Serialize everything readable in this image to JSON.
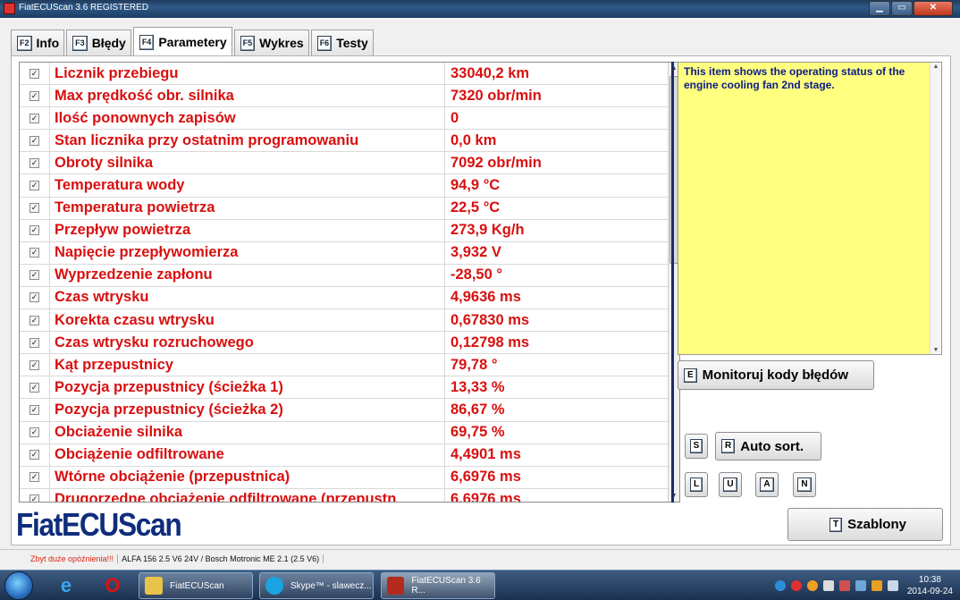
{
  "window": {
    "title": "FiatECUScan 3.6 REGISTERED"
  },
  "tabs": [
    {
      "key": "F2",
      "label": "Info"
    },
    {
      "key": "F3",
      "label": "Błędy"
    },
    {
      "key": "F4",
      "label": "Parametery"
    },
    {
      "key": "F5",
      "label": "Wykres"
    },
    {
      "key": "F6",
      "label": "Testy"
    }
  ],
  "params": [
    {
      "name": "Licznik przebiegu",
      "value": "33040,2 km"
    },
    {
      "name": "Max prędkość obr. silnika",
      "value": "7320 obr/min"
    },
    {
      "name": "Ilość ponownych zapisów",
      "value": "0"
    },
    {
      "name": "Stan licznika przy ostatnim programowaniu",
      "value": "0,0 km"
    },
    {
      "name": "Obroty silnika",
      "value": "7092 obr/min"
    },
    {
      "name": "Temperatura wody",
      "value": "94,9 °C"
    },
    {
      "name": "Temperatura powietrza",
      "value": "22,5 °C"
    },
    {
      "name": "Przepływ powietrza",
      "value": "273,9 Kg/h"
    },
    {
      "name": "Napięcie przepływomierza",
      "value": "3,932 V"
    },
    {
      "name": "Wyprzedzenie zapłonu",
      "value": "-28,50 °"
    },
    {
      "name": "Czas wtrysku",
      "value": "4,9636 ms"
    },
    {
      "name": "Korekta czasu wtrysku",
      "value": "0,67830 ms"
    },
    {
      "name": "Czas wtrysku rozruchowego",
      "value": "0,12798 ms"
    },
    {
      "name": "Kąt przepustnicy",
      "value": "79,78 °"
    },
    {
      "name": "Pozycja przepustnicy (ścieżka 1)",
      "value": "13,33 %"
    },
    {
      "name": "Pozycja przepustnicy (ścieżka 2)",
      "value": "86,67 %"
    },
    {
      "name": "Obciażenie silnika",
      "value": "69,75 %"
    },
    {
      "name": "Obciążenie odfiltrowane",
      "value": "4,4901 ms"
    },
    {
      "name": "Wtórne obciążenie (przepustnica)",
      "value": "6,6976 ms"
    },
    {
      "name": "Drugorzedne obciażenie odfiltrowane (przepustn",
      "value": "6,6976 ms"
    }
  ],
  "info": {
    "text": "This item shows the operating status of the engine cooling fan 2nd stage."
  },
  "buttons": {
    "monitor": {
      "key": "E",
      "label": "Monitoruj kody błędów"
    },
    "s_key": "S",
    "autosort": {
      "key": "R",
      "label": "Auto sort."
    },
    "l_key": "L",
    "u_key": "U",
    "a_key": "A",
    "n_key": "N",
    "templates": {
      "key": "T",
      "label": "Szablony"
    }
  },
  "logo": "FiatECUScan",
  "status": {
    "warning": "Zbyt duże opóźnienia!!!",
    "vehicle": "ALFA 156 2.5 V6 24V / Bosch Motronic ME 2.1 (2.5 V6)"
  },
  "taskbar": {
    "items": [
      {
        "label": "FiatECUScan"
      },
      {
        "label": "Skype™ - slawecz..."
      },
      {
        "label": "FiatECUScan 3.6 R..."
      }
    ],
    "time": "10:38",
    "date": "2014-09-24"
  }
}
